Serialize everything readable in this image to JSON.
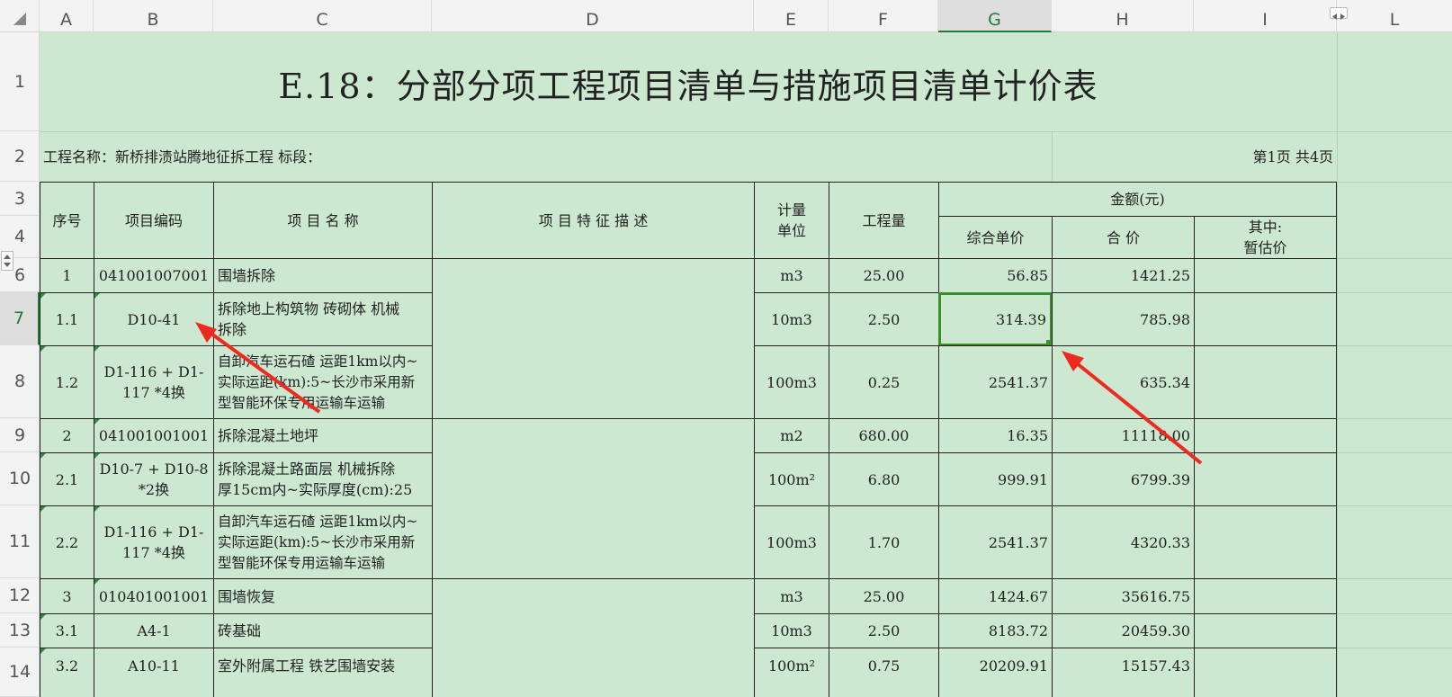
{
  "columns": [
    "A",
    "B",
    "C",
    "D",
    "E",
    "F",
    "G",
    "H",
    "I",
    "L"
  ],
  "selected_column": "G",
  "rows": [
    "1",
    "2",
    "3",
    "4",
    "6",
    "7",
    "8",
    "9",
    "10",
    "11",
    "12",
    "13",
    "14"
  ],
  "selected_row": "7",
  "title": "E.18：分部分项工程项目清单与措施项目清单计价表",
  "project_line": "工程名称：新桥排渍站腾地征拆工程   标段：",
  "page_info": "第1页   共4页",
  "headers": {
    "seq": "序号",
    "code": "项目编码",
    "name": "项 目 名 称",
    "desc": "项 目 特 征 描 述",
    "unit": "计量\n单位",
    "qty": "工程量",
    "amount": "金额(元)",
    "unit_price": "综合单价",
    "total": "合  价",
    "provisional": "其中:\n暂估价"
  },
  "table_rows": [
    {
      "seq": "1",
      "code": "041001007001",
      "name": "围墙拆除",
      "unit": "m3",
      "qty": "25.00",
      "price": "56.85",
      "total": "1421.25"
    },
    {
      "seq": "1.1",
      "code": "D10-41",
      "name": "拆除地上构筑物 砖砌体 机械\n拆除",
      "unit": "10m3",
      "qty": "2.50",
      "price": "314.39",
      "total": "785.98"
    },
    {
      "seq": "1.2",
      "code": "D1-116 + D1-\n117 *4换",
      "name": "自卸汽车运石碴 运距1km以内~\n实际运距(km):5~长沙市采用新\n型智能环保专用运输车运输",
      "unit": "100m3",
      "qty": "0.25",
      "price": "2541.37",
      "total": "635.34"
    },
    {
      "seq": "2",
      "code": "041001001001",
      "name": "拆除混凝土地坪",
      "unit": "m2",
      "qty": "680.00",
      "price": "16.35",
      "total": "11118.00"
    },
    {
      "seq": "2.1",
      "code": "D10-7 + D10-8\n*2换",
      "name": "拆除混凝土路面层 机械拆除\n厚15cm内~实际厚度(cm):25",
      "unit": "100m²",
      "qty": "6.80",
      "price": "999.91",
      "total": "6799.39"
    },
    {
      "seq": "2.2",
      "code": "D1-116 + D1-\n117 *4换",
      "name": "自卸汽车运石碴 运距1km以内~\n实际运距(km):5~长沙市采用新\n型智能环保专用运输车运输",
      "unit": "100m3",
      "qty": "1.70",
      "price": "2541.37",
      "total": "4320.33"
    },
    {
      "seq": "3",
      "code": "010401001001",
      "name": "围墙恢复",
      "unit": "m3",
      "qty": "25.00",
      "price": "1424.67",
      "total": "35616.75"
    },
    {
      "seq": "3.1",
      "code": "A4-1",
      "name": "砖基础",
      "unit": "10m3",
      "qty": "2.50",
      "price": "8183.72",
      "total": "20459.30"
    },
    {
      "seq": "3.2",
      "code": "A10-11",
      "name": "室外附属工程 铁艺围墙安装",
      "unit": "100m²",
      "qty": "0.75",
      "price": "20209.91",
      "total": "15157.43"
    }
  ],
  "colors": {
    "sheet_bg": "#cde8d0",
    "select_border": "#3f8e2e",
    "arrow": "#ee2a1f",
    "header_bg": "#f3f3f3"
  }
}
